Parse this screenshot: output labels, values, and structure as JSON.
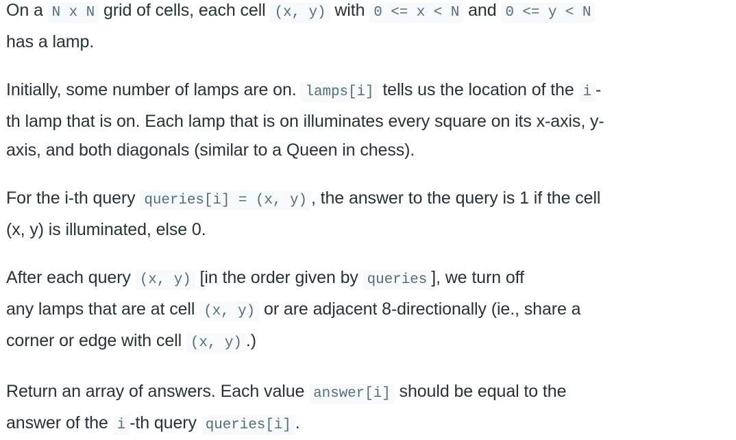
{
  "paragraphs": [
    {
      "segments": [
        {
          "t": "On a "
        },
        {
          "c": "N x N"
        },
        {
          "t": " grid of cells, each cell "
        },
        {
          "c": "(x, y)"
        },
        {
          "t": " with "
        },
        {
          "c": "0 <= x < N"
        },
        {
          "t": " and "
        },
        {
          "c": "0 <= y < N"
        },
        {
          "br": true
        },
        {
          "t": "has a lamp."
        }
      ]
    },
    {
      "segments": [
        {
          "t": "Initially, some number of lamps are on.  "
        },
        {
          "c": "lamps[i]"
        },
        {
          "t": " tells us the location of the "
        },
        {
          "c": "i"
        },
        {
          "t": "-"
        },
        {
          "br": true
        },
        {
          "t": "th lamp that is on.  Each lamp that is on illuminates every square on its x-axis, y-"
        },
        {
          "br": true
        },
        {
          "t": "axis, and both diagonals (similar to a Queen in chess)."
        }
      ]
    },
    {
      "segments": [
        {
          "t": "For the i-th query "
        },
        {
          "c": "queries[i] = (x, y)"
        },
        {
          "t": ", the answer to the query is 1 if the cell"
        },
        {
          "br": true
        },
        {
          "t": "(x, y) is illuminated, else 0."
        }
      ]
    },
    {
      "segments": [
        {
          "t": "After each query "
        },
        {
          "c": "(x, y)"
        },
        {
          "t": " [in the order given by "
        },
        {
          "c": "queries"
        },
        {
          "t": "], we turn off"
        },
        {
          "br": true
        },
        {
          "t": "any lamps that are at cell "
        },
        {
          "c": "(x, y)"
        },
        {
          "t": " or are adjacent 8-directionally (ie., share a"
        },
        {
          "br": true
        },
        {
          "t": "corner or edge with cell "
        },
        {
          "c": "(x, y)"
        },
        {
          "t": ".)"
        }
      ]
    },
    {
      "segments": [
        {
          "t": "Return an array of answers.  Each value "
        },
        {
          "c": "answer[i]"
        },
        {
          "t": " should be equal to the"
        },
        {
          "br": true
        },
        {
          "t": "answer of the "
        },
        {
          "c": "i"
        },
        {
          "t": "-th query "
        },
        {
          "c": "queries[i]"
        },
        {
          "t": "."
        }
      ]
    }
  ]
}
